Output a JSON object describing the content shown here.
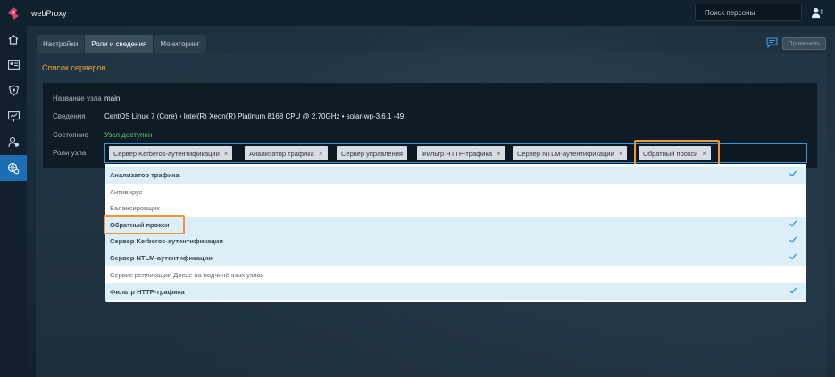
{
  "app": {
    "title": "webProxy"
  },
  "search": {
    "placeholder": "Поиск персоны"
  },
  "tabs": [
    {
      "label": "Настройки"
    },
    {
      "label": "Роли и сведения"
    },
    {
      "label": "Мониторинг"
    }
  ],
  "toolbar": {
    "apply_label": "Применить"
  },
  "section": {
    "title": "Список серверов"
  },
  "node": {
    "name_label": "Название узла",
    "name_value": "main",
    "info_label": "Сведения",
    "info_value": "CentOS Linux 7 (Core) • Intel(R) Xeon(R) Platinum 8168 CPU @ 2.70GHz • solar-wp-3.6.1 -49",
    "state_label": "Состояние",
    "state_value": "Узел доступен",
    "roles_label": "Роли узла"
  },
  "roles_selected": [
    {
      "label": "Сервер Kerberos-аутентификации"
    },
    {
      "label": "Анализатор трафика"
    },
    {
      "label": "Сервер управления"
    },
    {
      "label": "Фильтр HTTP-трафика"
    },
    {
      "label": "Сервер NTLM-аутентификации"
    },
    {
      "label": "Обратный прокси"
    }
  ],
  "dropdown_options": [
    {
      "label": "Анализатор трафика",
      "selected": true
    },
    {
      "label": "Антивирус",
      "selected": false
    },
    {
      "label": "Балансировщик",
      "selected": false
    },
    {
      "label": "Обратный прокси",
      "selected": true
    },
    {
      "label": "Сервер Kerberos-аутентификации",
      "selected": true
    },
    {
      "label": "Сервер NTLM-аутентификации",
      "selected": true
    },
    {
      "label": "Сервис репликации Досье на подчинённых узлах",
      "selected": false
    },
    {
      "label": "Фильтр HTTP-трафика",
      "selected": true
    }
  ],
  "chip_remove_glyph": "×",
  "icons": {
    "sidebar": [
      "home-icon",
      "id-card-icon",
      "shield-icon",
      "monitor-icon",
      "users-icon",
      "settings-network-icon"
    ]
  },
  "colors": {
    "accent": "#f0a030",
    "active": "#1d6db5",
    "ok": "#5fd07a",
    "highlight": "#f19433"
  }
}
